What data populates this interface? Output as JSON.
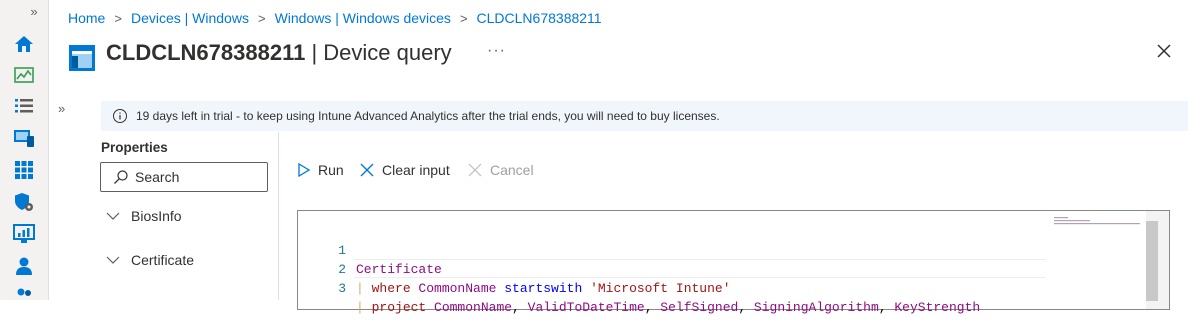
{
  "nav": {
    "expand_glyph": "»",
    "icons": [
      "home-icon",
      "dashboard-icon",
      "all-services-icon",
      "devices-icon",
      "apps-icon",
      "endpoint-security-icon",
      "reports-icon",
      "users-icon",
      "groups-icon"
    ]
  },
  "breadcrumb": [
    "Home",
    "Devices | Windows",
    "Windows | Windows devices",
    "CLDCLN678388211"
  ],
  "breadcrumb_separator": ">",
  "header": {
    "device_name": "CLDCLN678388211",
    "suffix": " | Device query",
    "more": "···",
    "close_icon": "close-icon"
  },
  "panel_expand_glyph": "»",
  "banner": {
    "icon": "info-icon",
    "text": "19 days left in trial - to keep using Intune Advanced Analytics after the trial ends, you will need to buy licenses."
  },
  "properties": {
    "title": "Properties",
    "search_placeholder": "Search",
    "items": [
      "BiosInfo",
      "Certificate"
    ]
  },
  "toolbar": {
    "run": "Run",
    "clear": "Clear input",
    "cancel": "Cancel"
  },
  "editor": {
    "line_numbers": [
      "1",
      "2",
      "3"
    ],
    "lines": {
      "l1": "Certificate",
      "l2_pipe": "| ",
      "l2_where": "where ",
      "l2_col": "CommonName ",
      "l2_op": "startswith ",
      "l2_str": "'Microsoft Intune'",
      "l3_pipe": "| ",
      "l3_project": "project ",
      "l3_c1": "CommonName",
      "l3_c2": "ValidToDateTime",
      "l3_c3": "SelfSigned",
      "l3_c4": "SigningAlgorithm",
      "l3_c5": "KeyStrength",
      "comma": ", "
    }
  },
  "colors": {
    "accent": "#0078d4",
    "banner_bg": "#f0f6fc",
    "rail_bg": "#f3f2f1"
  }
}
